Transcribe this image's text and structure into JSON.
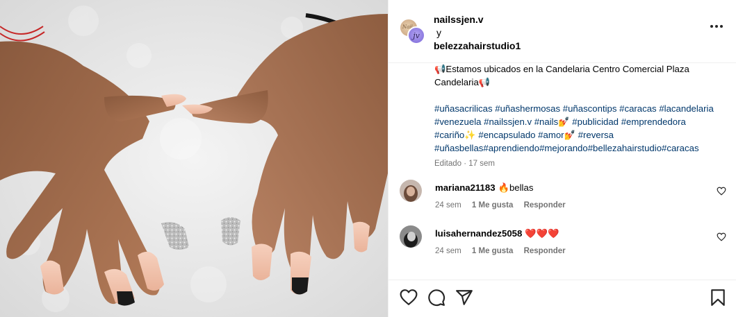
{
  "post": {
    "author": "nailssjen.v",
    "conjunction": "y",
    "coauthor": "belezzahairstudio1",
    "avatar_monogram": "jv",
    "avatar_logo_text": "Nail",
    "caption_line1": "📢Estamos ubicados en la Candelaria Centro Comercial Plaza Candelaria📢",
    "hashtags": [
      "#uñasacrilicas",
      " ",
      "#uñashermosas",
      " ",
      "#uñascontips",
      " ",
      "#caracas",
      " ",
      "#lacandelaria",
      " ",
      "#venezuela",
      " ",
      "#nailssjen.v",
      " ",
      "#nails💅",
      " ",
      "#publicidad",
      " ",
      "#emprendedora",
      " ",
      "#cariño✨",
      " ",
      "#encapsulado",
      " ",
      "#amor💅",
      " ",
      "#reversa",
      " ",
      "#uñasbellas",
      "#aprendiendo",
      "#mejorando",
      "#bellezahairstudio",
      "#caracas"
    ],
    "edited": "Editado · 17 sem"
  },
  "comments": [
    {
      "user": "mariana21183",
      "text": "🔥bellas",
      "time": "24 sem",
      "likes": "1 Me gusta",
      "reply": "Responder"
    },
    {
      "user": "luisahernandez5058",
      "text": "❤️❤️❤️",
      "time": "24 sem",
      "likes": "1 Me gusta",
      "reply": "Responder"
    }
  ],
  "icons": {
    "more": "more-options-icon",
    "like": "heart-icon",
    "comment": "comment-icon",
    "share": "send-icon",
    "save": "bookmark-icon"
  },
  "colors": {
    "link": "#00376b",
    "secondary_text": "#737373",
    "divider": "#efefef",
    "nail_pink": "#efbfa6",
    "nail_black": "#1a1a1a",
    "nail_silver": "#c9c9c9"
  }
}
